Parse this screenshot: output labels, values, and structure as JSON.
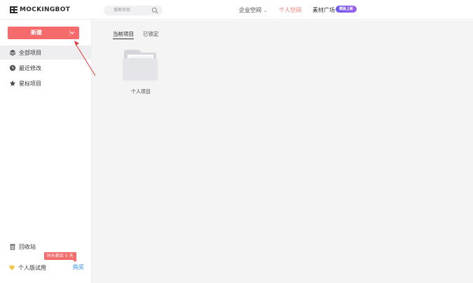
{
  "header": {
    "brand": "MOCKINGBOT",
    "search": {
      "placeholder": "搜索项目"
    },
    "nav": {
      "enterprise": "企业空间",
      "personal": "个人空间",
      "market": "素材广场",
      "market_badge": "模板上新"
    }
  },
  "sidebar": {
    "new_button": "新建",
    "items": [
      {
        "label": "全部项目",
        "icon": "layers-icon"
      },
      {
        "label": "最近修改",
        "icon": "clock-icon"
      },
      {
        "label": "星标项目",
        "icon": "star-icon"
      }
    ],
    "trash": "回收站",
    "plan": {
      "label": "个人版试用",
      "buy": "购买",
      "tip": "时长剩余 5 天"
    }
  },
  "main": {
    "tabs": [
      {
        "label": "当前项目",
        "active": true
      },
      {
        "label": "已锁定",
        "active": false
      }
    ],
    "folders": [
      {
        "label": "个人项目"
      }
    ]
  },
  "colors": {
    "accent": "#f56a6a",
    "link": "#2a8cf0",
    "badge": "#7a5cf0",
    "annotation": "#e23a3a"
  }
}
